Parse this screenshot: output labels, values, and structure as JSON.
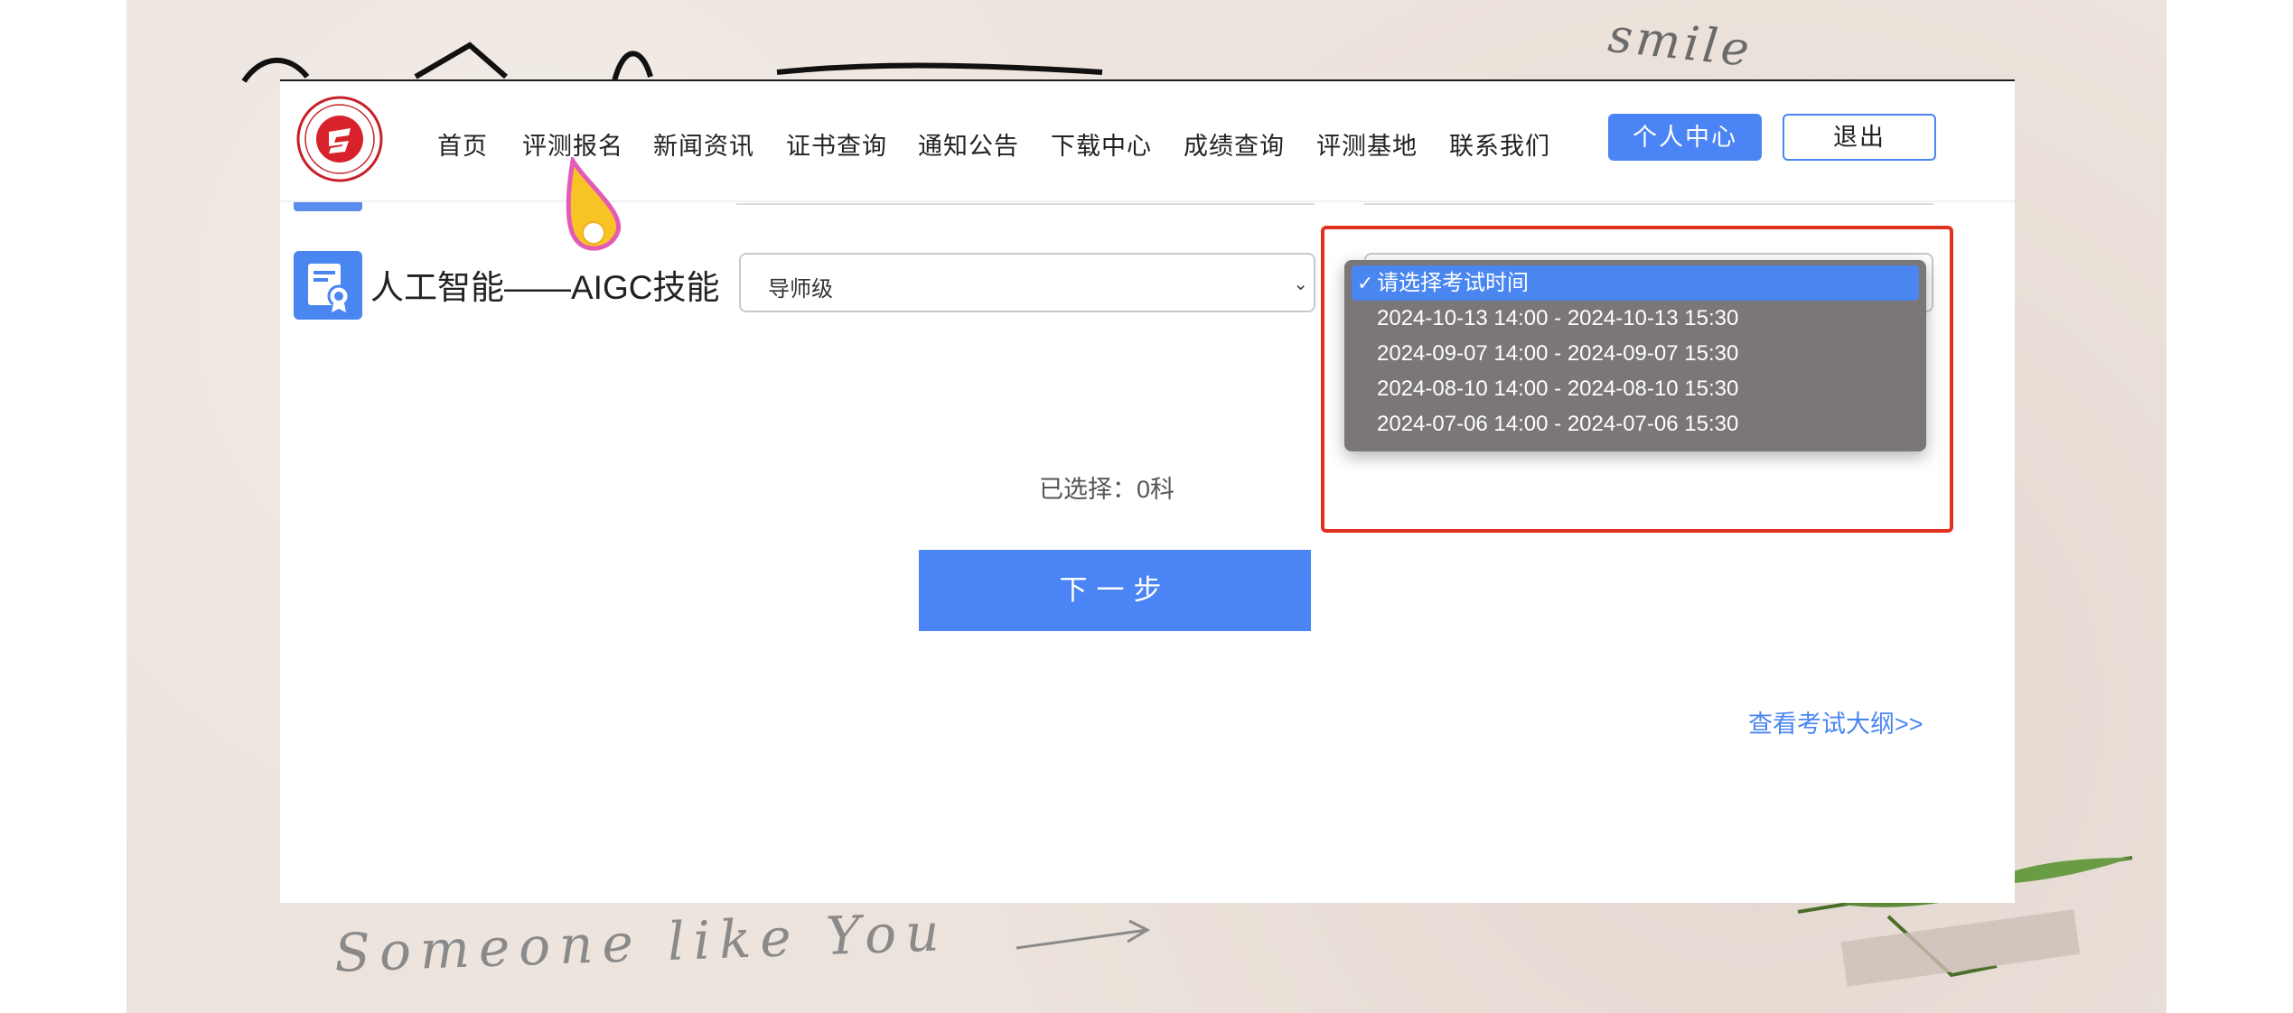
{
  "nav": {
    "items": [
      {
        "label": "首页"
      },
      {
        "label": "评测报名"
      },
      {
        "label": "新闻资讯"
      },
      {
        "label": "证书查询"
      },
      {
        "label": "通知公告"
      },
      {
        "label": "下载中心"
      },
      {
        "label": "成绩查询"
      },
      {
        "label": "评测基地"
      },
      {
        "label": "联系我们"
      }
    ],
    "personal_center_label": "个人中心",
    "logout_label": "退出"
  },
  "exam_row": {
    "title": "人工智能——AIGC技能",
    "level_value": "导师级",
    "time_dropdown": {
      "options": [
        {
          "label": "请选择考试时间",
          "selected": true
        },
        {
          "label": "2024-10-13 14:00 - 2024-10-13 15:30",
          "selected": false
        },
        {
          "label": "2024-09-07 14:00 - 2024-09-07 15:30",
          "selected": false
        },
        {
          "label": "2024-08-10 14:00 - 2024-08-10 15:30",
          "selected": false
        },
        {
          "label": "2024-07-06 14:00 - 2024-07-06 15:30",
          "selected": false
        }
      ],
      "check_mark": "✓"
    }
  },
  "selected_count_text": "已选择：0科",
  "next_step_label": "下一步",
  "syllabus_link": "查看考试大纲>>",
  "decor": {
    "handwriting_top": "smile",
    "handwriting_bottom": "Someone like You"
  },
  "colors": {
    "primary": "#4b84f5",
    "highlight_border": "#e2301e",
    "dropdown_bg": "#7b7778",
    "paper_bg": "#ece3dc"
  },
  "icons": {
    "logo": "round-red-emblem-logo",
    "certificate": "certificate-icon",
    "cursor": "pointer-cursor-icon"
  }
}
